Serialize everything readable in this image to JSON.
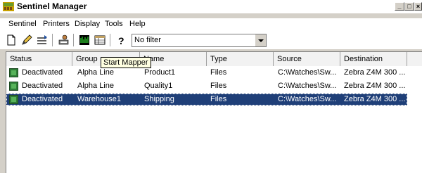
{
  "window": {
    "title": "Sentinel Manager",
    "controls": {
      "minimize": "_",
      "maximize": "□",
      "close": "×"
    }
  },
  "menu": [
    "Sentinel",
    "Printers",
    "Display",
    "Tools",
    "Help"
  ],
  "toolbar": {
    "buttons": [
      "new-document-icon",
      "edit-pencil-icon",
      "printer-queue-icon",
      "user-printer-icon",
      "waveform-icon",
      "table-list-icon",
      "help-icon"
    ],
    "filter_value": "No filter"
  },
  "tooltip": "Start Mapper",
  "table": {
    "columns": [
      "Status",
      "Group",
      "Name",
      "Type",
      "Source",
      "Destination"
    ],
    "rows": [
      {
        "status": "Deactivated",
        "group": "Alpha Line",
        "name": "Product1",
        "type": "Files",
        "source": "C:\\Watches\\Sw...",
        "destination": "Zebra Z4M 300 ..."
      },
      {
        "status": "Deactivated",
        "group": "Alpha Line",
        "name": "Quality1",
        "type": "Files",
        "source": "C:\\Watches\\Sw...",
        "destination": "Zebra Z4M 300 ..."
      },
      {
        "status": "Deactivated",
        "group": "Warehouse1",
        "name": "Shipping",
        "type": "Files",
        "source": "C:\\Watches\\Sw...",
        "destination": "Zebra Z4M 300 ..."
      }
    ],
    "selected_row": 2
  },
  "colors": {
    "selection": "#1f3f78",
    "status_icon": "#2f7d37",
    "tooltip_bg": "#ffffe1"
  }
}
